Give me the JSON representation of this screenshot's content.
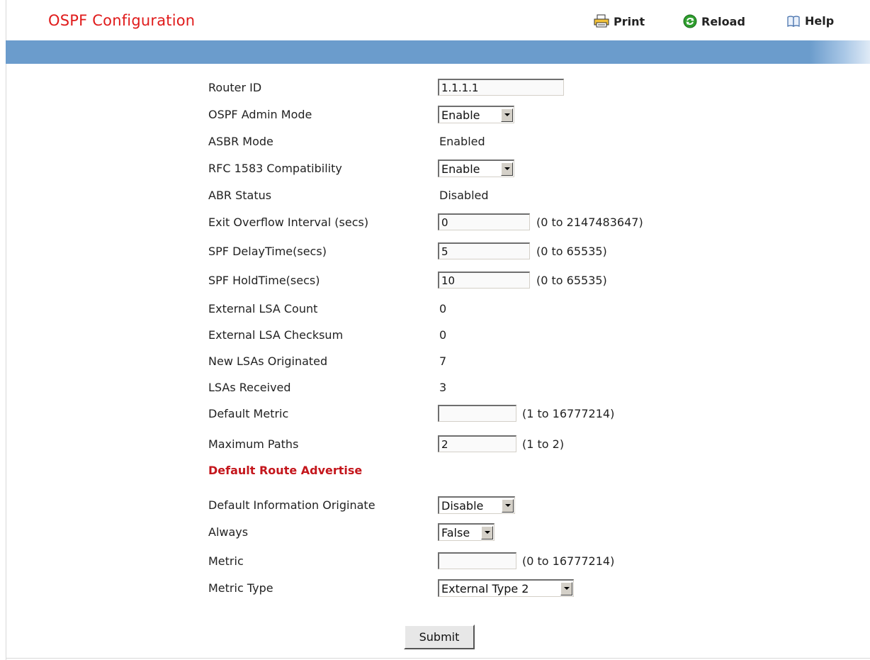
{
  "page": {
    "title": "OSPF Configuration",
    "actions": {
      "print": "Print",
      "reload": "Reload",
      "help": "Help"
    }
  },
  "form": {
    "router_id": {
      "label": "Router ID",
      "value": "1.1.1.1"
    },
    "admin_mode": {
      "label": "OSPF Admin Mode",
      "value": "Enable"
    },
    "asbr_mode": {
      "label": "ASBR Mode",
      "value": "Enabled"
    },
    "rfc1583": {
      "label": "RFC 1583 Compatibility",
      "value": "Enable"
    },
    "abr_status": {
      "label": "ABR Status",
      "value": "Disabled"
    },
    "exit_overflow": {
      "label": "Exit Overflow Interval (secs)",
      "value": "0",
      "range": "(0 to 2147483647)"
    },
    "spf_delay": {
      "label": "SPF DelayTime(secs)",
      "value": "5",
      "range": "(0 to 65535)"
    },
    "spf_hold": {
      "label": "SPF HoldTime(secs)",
      "value": "10",
      "range": "(0 to 65535)"
    },
    "ext_lsa_count": {
      "label": "External LSA Count",
      "value": "0"
    },
    "ext_lsa_checksum": {
      "label": "External LSA Checksum",
      "value": "0"
    },
    "new_lsas": {
      "label": "New LSAs Originated",
      "value": "7"
    },
    "lsas_received": {
      "label": "LSAs Received",
      "value": "3"
    },
    "default_metric": {
      "label": "Default Metric",
      "value": "",
      "range": "(1 to 16777214)"
    },
    "max_paths": {
      "label": "Maximum Paths",
      "value": "2",
      "range": "(1 to 2)"
    }
  },
  "default_route": {
    "heading": "Default Route Advertise",
    "info_originate": {
      "label": "Default Information Originate",
      "value": "Disable"
    },
    "always": {
      "label": "Always",
      "value": "False"
    },
    "metric": {
      "label": "Metric",
      "value": "",
      "range": "(0 to 16777214)"
    },
    "metric_type": {
      "label": "Metric Type",
      "value": "External Type 2"
    }
  },
  "submit_label": "Submit"
}
